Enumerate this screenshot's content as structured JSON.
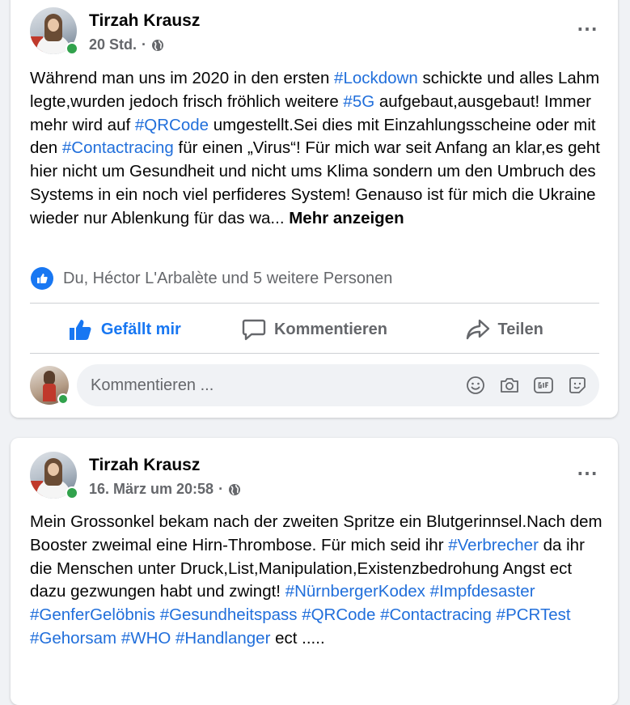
{
  "posts": [
    {
      "author": "Tirzah Krausz",
      "time": "20 Std.",
      "separator": "·",
      "text_segments": [
        {
          "t": "Während man uns im 2020 in den ersten ",
          "tag": false
        },
        {
          "t": "#Lockdown",
          "tag": true
        },
        {
          "t": " schickte und alles Lahm legte,wurden jedoch frisch fröhlich weitere ",
          "tag": false
        },
        {
          "t": "#5G",
          "tag": true
        },
        {
          "t": " aufgebaut,ausgebaut! Immer mehr wird auf ",
          "tag": false
        },
        {
          "t": "#QRCode",
          "tag": true
        },
        {
          "t": " umgestellt.Sei dies mit Einzahlungsscheine oder mit den ",
          "tag": false
        },
        {
          "t": "#Contactracing",
          "tag": true
        },
        {
          "t": " für einen „Virus“! Für mich war seit Anfang an klar,es geht hier nicht um Gesundheit und nicht ums Klima sondern um den Umbruch des Systems in ein noch viel perfideres System! Genauso ist für mich die Ukraine wieder nur Ablenkung für das wa... ",
          "tag": false
        }
      ],
      "see_more": "Mehr anzeigen",
      "reactions_text": "Du, Héctor L'Arbalète und 5 weitere Personen",
      "actions": {
        "like": "Gefällt mir",
        "comment": "Kommentieren",
        "share": "Teilen"
      },
      "comment_placeholder": "Kommentieren ...",
      "more_icon": "⋯"
    },
    {
      "author": "Tirzah Krausz",
      "time": "16. März um 20:58",
      "separator": "·",
      "text_segments": [
        {
          "t": "Mein Grossonkel bekam nach der zweiten Spritze ein Blutgerinnsel.Nach dem Booster zweimal eine Hirn-Thrombose. Für mich seid ihr ",
          "tag": false
        },
        {
          "t": "#Verbrecher",
          "tag": true
        },
        {
          "t": " da ihr die Menschen unter Druck,List,Manipulation,Existenzbedrohung Angst ect dazu gezwungen habt und zwingt! ",
          "tag": false
        },
        {
          "t": "#NürnbergerKodex",
          "tag": true
        },
        {
          "t": " ",
          "tag": false
        },
        {
          "t": "#Impfdesaster",
          "tag": true
        },
        {
          "t": " ",
          "tag": false
        },
        {
          "t": "#GenferGelöbnis",
          "tag": true
        },
        {
          "t": " ",
          "tag": false
        },
        {
          "t": "#Gesundheitspass",
          "tag": true
        },
        {
          "t": " ",
          "tag": false
        },
        {
          "t": "#QRCode",
          "tag": true
        },
        {
          "t": " ",
          "tag": false
        },
        {
          "t": "#Contactracing",
          "tag": true
        },
        {
          "t": " ",
          "tag": false
        },
        {
          "t": "#PCRTest",
          "tag": true
        },
        {
          "t": " ",
          "tag": false
        },
        {
          "t": "#Gehorsam",
          "tag": true
        },
        {
          "t": " ",
          "tag": false
        },
        {
          "t": "#WHO",
          "tag": true
        },
        {
          "t": " ",
          "tag": false
        },
        {
          "t": "#Handlanger",
          "tag": true
        },
        {
          "t": " ect .....",
          "tag": false
        }
      ],
      "more_icon": "⋯"
    }
  ],
  "colors": {
    "hashtag": "#216fdb",
    "like_active": "#1877f2",
    "secondary_text": "#65676b",
    "online": "#31a24c"
  },
  "icons": [
    "globe-icon",
    "more-options-icon",
    "like-badge-icon",
    "thumbs-up-icon",
    "comment-icon",
    "share-icon",
    "emoji-icon",
    "camera-icon",
    "gif-icon",
    "sticker-icon"
  ]
}
